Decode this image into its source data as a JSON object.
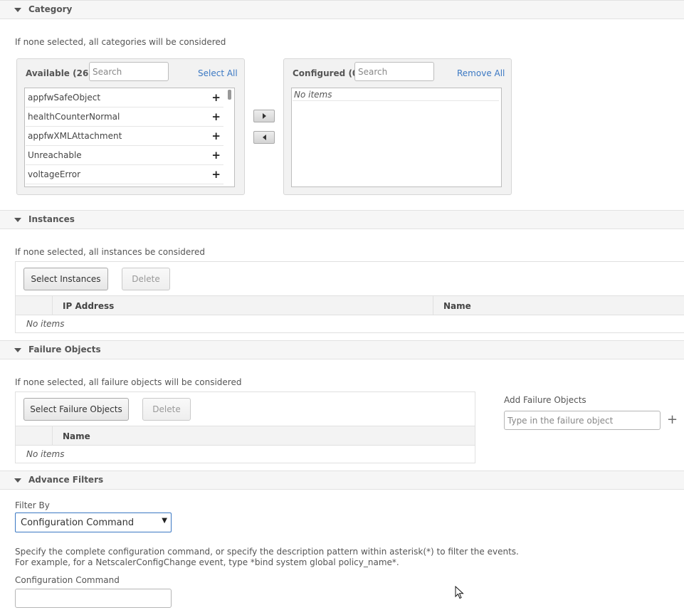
{
  "category": {
    "title": "Category",
    "hint": "If none selected, all categories will be considered",
    "available": {
      "title": "Available (262)",
      "search_placeholder": "Search",
      "select_all": "Select All",
      "items": [
        "appfwSafeObject",
        "healthCounterNormal",
        "appfwXMLAttachment",
        "Unreachable",
        "voltageError"
      ]
    },
    "configured": {
      "title": "Configured (0)",
      "search_placeholder": "Search",
      "remove_all": "Remove All",
      "empty": "No items"
    }
  },
  "instances": {
    "title": "Instances",
    "hint": "If none selected, all instances be considered",
    "select_button": "Select Instances",
    "delete_button": "Delete",
    "columns": [
      "IP Address",
      "Name"
    ],
    "empty": "No items"
  },
  "failure_objects": {
    "title": "Failure Objects",
    "hint": "If none selected, all failure objects will be considered",
    "select_button": "Select Failure Objects",
    "delete_button": "Delete",
    "columns": [
      "Name"
    ],
    "empty": "No items",
    "add_label": "Add Failure Objects",
    "add_placeholder": "Type in the failure object"
  },
  "advance_filters": {
    "title": "Advance Filters",
    "filter_by_label": "Filter By",
    "filter_by_value": "Configuration Command",
    "description_line1": "Specify the complete configuration command, or specify the description pattern within asterisk(*) to filter the events.",
    "description_line2": "For example, for a NetscalerConfigChange event, type *bind system global policy_name*.",
    "command_label": "Configuration Command",
    "command_value": ""
  },
  "colors": {
    "accent": "#3b78c3",
    "header_bg": "#f6f6f6",
    "panel_bg": "#f2f2f2"
  }
}
